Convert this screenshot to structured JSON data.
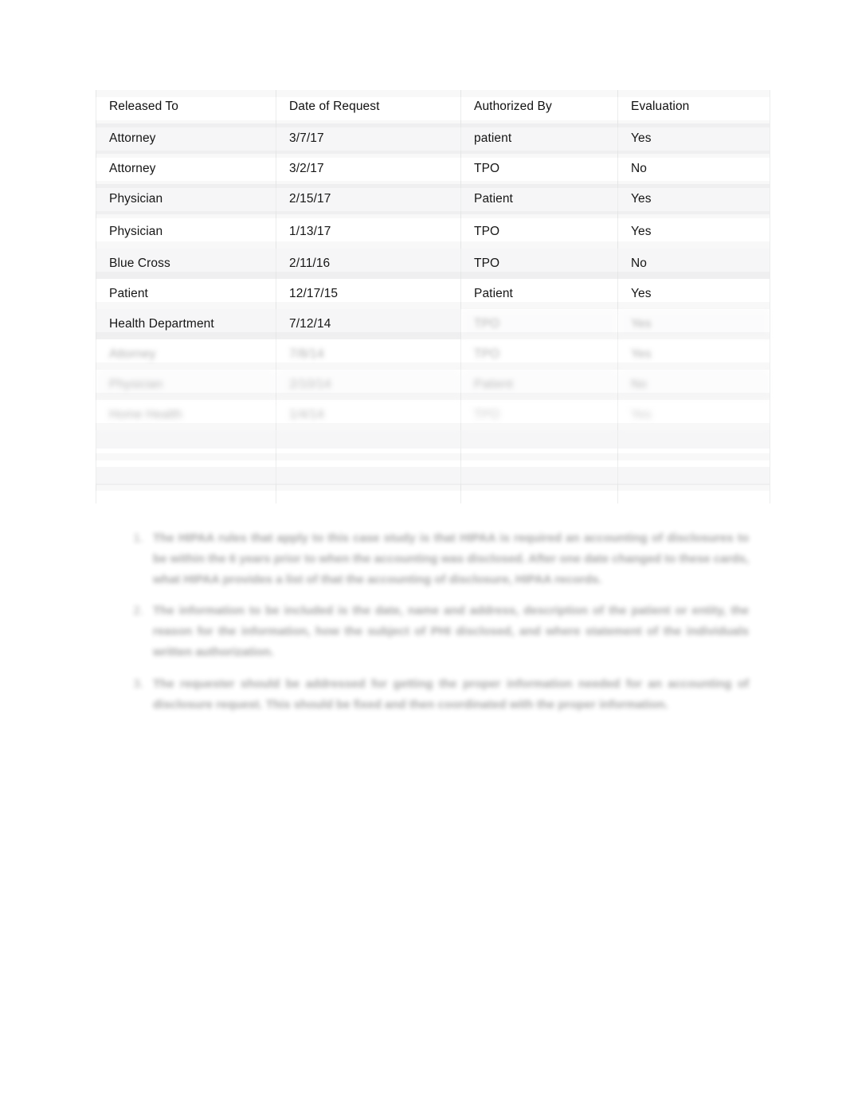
{
  "document": {
    "type": "word-processor-page",
    "page_background": "#ffffff",
    "text_color": "#161616"
  },
  "table": {
    "name": "accounting-of-disclosures-table",
    "columns": [
      "Released To",
      "Date of Request",
      "Authorized By",
      "Evaluation"
    ],
    "rows": [
      {
        "released_to": "Attorney",
        "date_of_request": "3/7/17",
        "authorized_by": "patient",
        "evaluation": "Yes",
        "legible": true
      },
      {
        "released_to": "Attorney",
        "date_of_request": "3/2/17",
        "authorized_by": "TPO",
        "evaluation": "No",
        "legible": true
      },
      {
        "released_to": "Physician",
        "date_of_request": "2/15/17",
        "authorized_by": "Patient",
        "evaluation": "Yes",
        "legible": true
      },
      {
        "released_to": "Physician",
        "date_of_request": "1/13/17",
        "authorized_by": "TPO",
        "evaluation": "Yes",
        "legible": true
      },
      {
        "released_to": "Blue Cross",
        "date_of_request": "2/11/16",
        "authorized_by": "TPO",
        "evaluation": "No",
        "legible": true
      },
      {
        "released_to": "Patient",
        "date_of_request": "12/17/15",
        "authorized_by": "Patient",
        "evaluation": "Yes",
        "legible": true
      },
      {
        "released_to": "Health Department",
        "date_of_request": "7/12/14",
        "authorized_by": "TPO",
        "evaluation": "Yes",
        "legible": "partial"
      },
      {
        "released_to": "Attorney",
        "date_of_request": "7/8/14",
        "authorized_by": "TPO",
        "evaluation": "Yes",
        "legible": false
      },
      {
        "released_to": "Physician",
        "date_of_request": "2/10/14",
        "authorized_by": "Patient",
        "evaluation": "No",
        "legible": false
      },
      {
        "released_to": "Home Health",
        "date_of_request": "1/4/14",
        "authorized_by": "TPO",
        "evaluation": "Yes",
        "legible": false
      }
    ],
    "empty_rows": 3
  },
  "notes": {
    "name": "numbered-notes-list",
    "items": [
      {
        "marker": "1.",
        "text": "The HIPAA rules that apply to this case study is that HIPAA is required an accounting of disclosures to be within the 6 years prior to when the accounting was disclosed. After one date changed to these cards, what HIPAA provides a list of that the accounting of disclosure, HIPAA records."
      },
      {
        "marker": "2.",
        "text": "The information to be included is the date, name and address, description of the patient or entity, the reason for the information, how the subject of PHI disclosed, and where statement of the individuals written authorization."
      },
      {
        "marker": "3.",
        "text": "The requester should be addressed for getting the proper information needed for an accounting of disclosure request. This should be fixed and then coordinated with the proper information."
      }
    ]
  }
}
